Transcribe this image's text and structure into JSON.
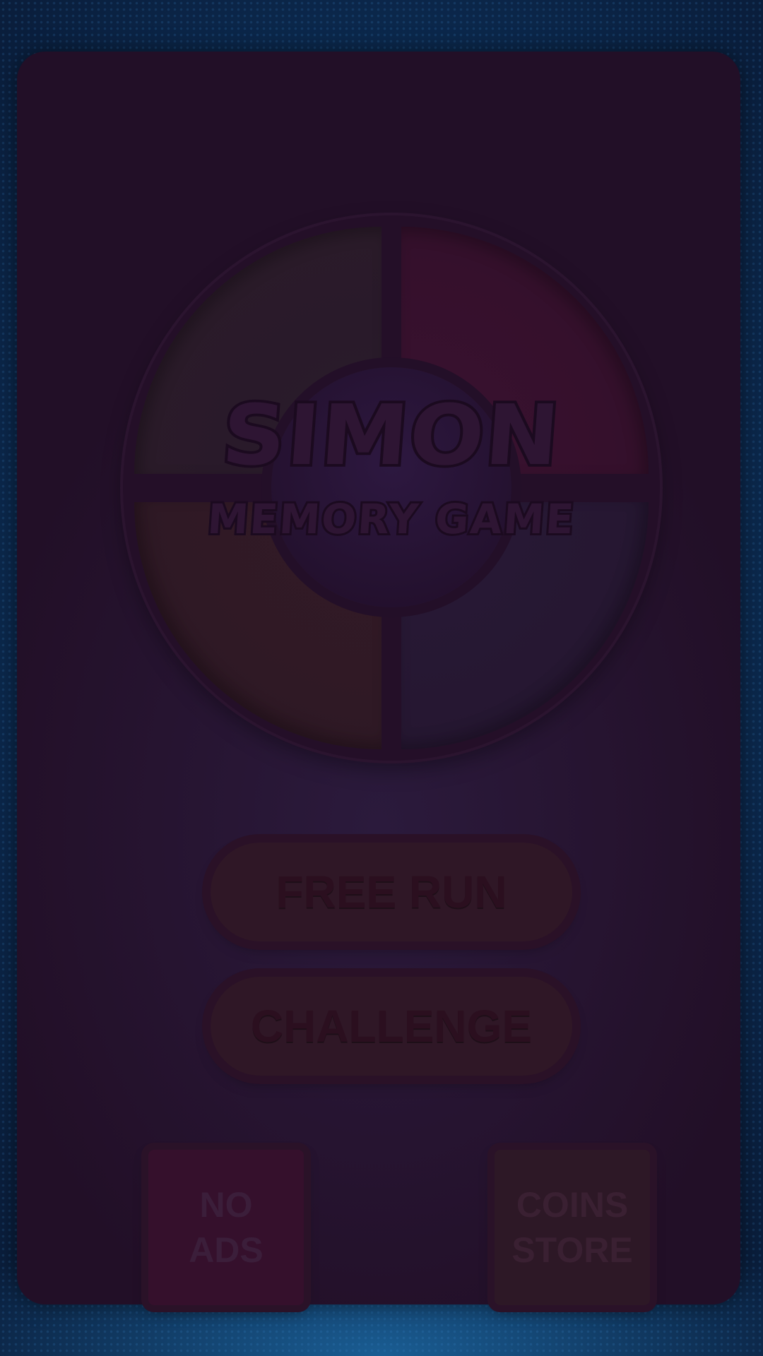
{
  "game": {
    "title": "SIMON",
    "subtitle": "MEMORY GAME"
  },
  "buttons": {
    "free_run": "FREE RUN",
    "challenge": "CHALLENGE",
    "no_ads_line1": "NO",
    "no_ads_line2": "ADS",
    "coins_store_line1": "COINS",
    "coins_store_line2": "STORE"
  },
  "colors": {
    "background": "#0c2d54",
    "panel": "#220f27",
    "quad_green": "#291a2a",
    "quad_red": "#35102c",
    "quad_yellow": "#2f1925",
    "quad_blue": "#261732"
  }
}
